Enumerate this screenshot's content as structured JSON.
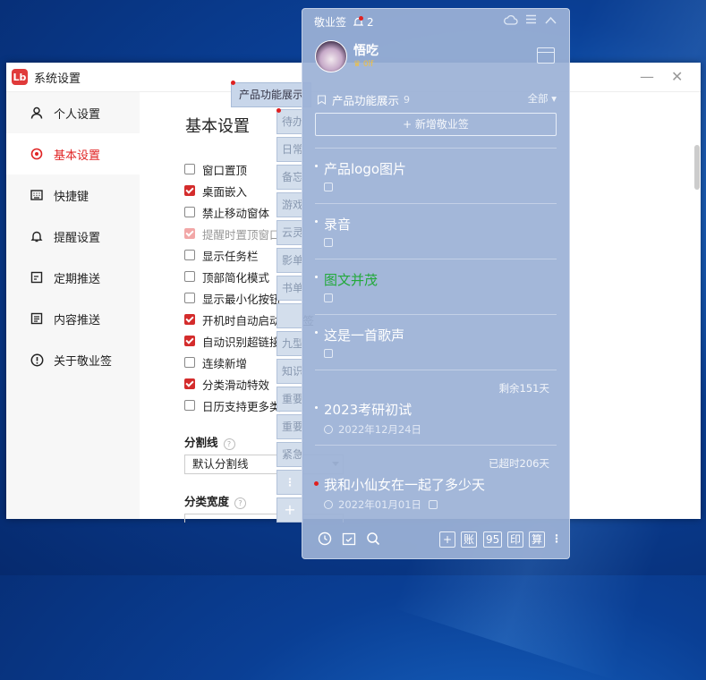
{
  "settings_window": {
    "title": "系统设置",
    "logo_text": "Lb",
    "controls": [
      "—",
      "✕"
    ],
    "sidebar": [
      {
        "label": "个人设置",
        "icon": "person-icon"
      },
      {
        "label": "基本设置",
        "icon": "target-icon",
        "active": true
      },
      {
        "label": "快捷键",
        "icon": "keyboard-icon"
      },
      {
        "label": "提醒设置",
        "icon": "bell-icon"
      },
      {
        "label": "定期推送",
        "icon": "calendar-icon"
      },
      {
        "label": "内容推送",
        "icon": "document-icon"
      },
      {
        "label": "关于敬业签",
        "icon": "info-icon"
      }
    ],
    "section_title": "基本设置",
    "options": [
      {
        "label": "窗口置顶",
        "checked": false
      },
      {
        "label": "桌面嵌入",
        "checked": true
      },
      {
        "label": "禁止移动窗体",
        "checked": false
      },
      {
        "label": "提醒时置顶窗口",
        "checked": true,
        "disabled": true
      },
      {
        "label": "显示任务栏",
        "checked": false
      },
      {
        "label": "顶部简化模式",
        "checked": false
      },
      {
        "label": "显示最小化按钮",
        "checked": false
      },
      {
        "label": "开机时自动启动敬业签",
        "checked": true
      },
      {
        "label": "自动识别超链接",
        "checked": true
      },
      {
        "label": "连续新增",
        "checked": false
      },
      {
        "label": "分类滑动特效",
        "checked": true
      },
      {
        "label": "日历支持更多类型",
        "checked": false
      }
    ],
    "divider_label": "分割线",
    "divider_value": "默认分割线",
    "width_label": "分类宽度",
    "help_glyph": "?"
  },
  "popup": {
    "feature_tag": "产品功能展示",
    "tabs": [
      "待办",
      "日常",
      "备忘",
      "游戏",
      "云灵",
      "影单",
      "书单",
      "",
      "九型",
      "知识",
      "重要",
      "重要",
      "紧急"
    ],
    "more_glyph": "⋮",
    "add_glyph": "+"
  },
  "notes_panel": {
    "app_name": "敬业签",
    "reminder_count": "2",
    "top_icons": [
      "cloud-icon",
      "menu-icon",
      "collapse-icon"
    ],
    "user": {
      "name": "悟吃",
      "badge": "♛ 0lf"
    },
    "category": {
      "name": "产品功能展示",
      "count": "9"
    },
    "filter": "全部 ▾",
    "new_button": "+ 新增敬业签",
    "notes": [
      {
        "title": "产品logo图片",
        "color": "#ffffff"
      },
      {
        "title": "录音",
        "color": "#ffffff"
      },
      {
        "title": "图文并茂",
        "color": "#22a93a"
      },
      {
        "title": "这是一首歌声",
        "color": "#ffffff"
      },
      {
        "title": "2023考研初试",
        "color": "#ffffff",
        "remaining": "剩余151天",
        "date": "2022年12月24日"
      },
      {
        "title": "我和小仙女在一起了多少天",
        "color": "#ffffff",
        "remaining": "已超时206天",
        "date": "2022年01月01日"
      }
    ],
    "bottom_icons": [
      "clock-icon",
      "check-calendar-icon",
      "search-icon"
    ],
    "bottom_buttons": [
      "+",
      "账",
      "95",
      "印",
      "算",
      "⋮"
    ]
  }
}
